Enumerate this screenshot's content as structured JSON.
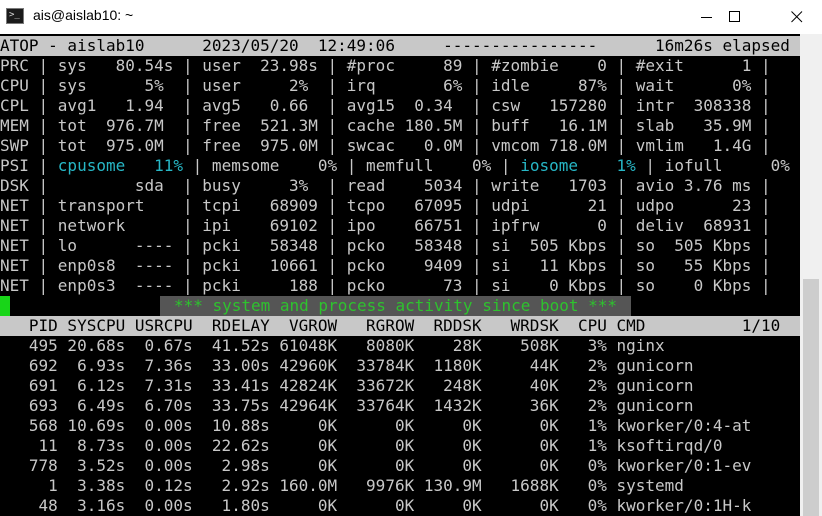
{
  "window": {
    "title": "ais@aislab10: ~",
    "icon": "terminal-icon",
    "buttons": [
      "minimize-icon",
      "maximize-icon",
      "close-icon"
    ]
  },
  "colors": {
    "background": "#000000",
    "text": "#c8c8c8",
    "header_bar": "#c8c8c8",
    "cyan": "#27b7c6",
    "green": "#2ec22e",
    "cursor": "#18d518"
  },
  "atop": {
    "header": "ATOP - aislab10      2023/05/20  12:49:06     ----------------      16m26s elapsed",
    "sys_lines": [
      "PRC | sys   80.54s | user  23.98s | #proc     89 | #zombie    0 | #exit      1 |",
      "CPU | sys      5%  | user     2%  | irq       6% | idle     87% | wait      0% |",
      "CPL | avg1   1.94  | avg5   0.66  | avg15  0.34  | csw   157280 | intr  308338 |",
      "MEM | tot  976.7M  | free  521.3M | cache 180.5M | buff   16.1M | slab   35.9M |",
      "SWP | tot  975.0M  | free  975.0M | swcac   0.0M | vmcom 718.0M | vmlim   1.4G |"
    ],
    "psi_line": {
      "prefix": "PSI | ",
      "cpusome": "cpusome   11%",
      "mid": " | memsome    0% | memfull    0% | ",
      "iosome": "iosome    1%",
      "suffix": " | iofull     0% |"
    },
    "dev_lines": [
      "DSK |         sda  | busy     3%  | read    5034 | write   1703 | avio 3.76 ms |",
      "NET | transport    | tcpi   68909 | tcpo   67095 | udpi      21 | udpo      23 |",
      "NET | network      | ipi    69102 | ipo    66751 | ipfrw      0 | deliv  68931 |",
      "NET | lo      ---- | pcki   58348 | pcko   58348 | si  505 Kbps | so  505 Kbps |",
      "NET | enp0s8  ---- | pcki   10661 | pcko    9409 | si   11 Kbps | so   55 Kbps |",
      "NET | enp0s3  ---- | pcki     188 | pcko      73 | si    0 Kbps | so    0 Kbps |"
    ],
    "banner": "*** system and process activity since boot ***",
    "process_header": "   PID SYSCPU USRCPU  RDELAY  VGROW   RGROW  RDDSK   WRDSK  CPU CMD          1/10",
    "process_rows": [
      "   495 20.68s  0.67s  41.52s 61048K   8080K    28K    508K   3% nginx",
      "   692  6.93s  7.36s  33.00s 42960K  33784K  1180K     44K   2% gunicorn",
      "   691  6.12s  7.31s  33.41s 42824K  33672K   248K     40K   2% gunicorn",
      "   693  6.49s  6.70s  33.75s 42964K  33764K  1432K     36K   2% gunicorn",
      "   568 10.69s  0.00s  10.88s     0K      0K     0K      0K   1% kworker/0:4-at",
      "    11  8.73s  0.00s  22.62s     0K      0K     0K      0K   1% ksoftirqd/0",
      "   778  3.52s  0.00s   2.98s     0K      0K     0K      0K   0% kworker/0:1-ev",
      "     1  3.38s  0.12s   2.92s 160.0M   9976K 130.9M   1688K   0% systemd",
      "    48  3.16s  0.00s   1.80s     0K      0K     0K      0K   0% kworker/0:1H-k"
    ]
  }
}
